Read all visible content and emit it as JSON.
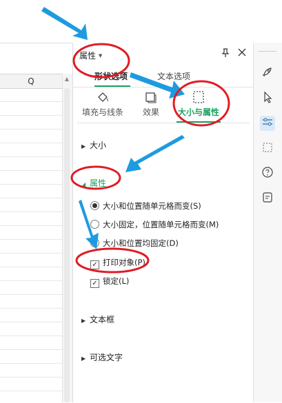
{
  "sheet": {
    "column_label": "Q"
  },
  "panel": {
    "title": "属性",
    "title_dropdown_icon": "chevron-down-icon",
    "tabs": [
      {
        "label": "形状选项",
        "active": true
      },
      {
        "label": "文本选项",
        "active": false
      }
    ],
    "subtabs": [
      {
        "label": "填充与线条",
        "icon": "fill-bucket-icon",
        "active": false
      },
      {
        "label": "效果",
        "icon": "effects-icon",
        "active": false
      },
      {
        "label": "大小与属性",
        "icon": "size-properties-icon",
        "active": true
      }
    ],
    "sections": {
      "size": "大小",
      "properties": "属性",
      "textbox": "文本框",
      "alt_text": "可选文字"
    },
    "radio_options": [
      {
        "label": "大小和位置随单元格而变(S)",
        "checked": true
      },
      {
        "label": "大小固定，位置随单元格而变(M)",
        "checked": false
      },
      {
        "label": "大小和位置均固定(D)",
        "checked": false
      }
    ],
    "checkbox_options": [
      {
        "label": "打印对象(P)",
        "checked": true,
        "mark": "✓"
      },
      {
        "label": "锁定(L)",
        "checked": true,
        "mark": "✓"
      }
    ]
  },
  "toolbar_icons": [
    "rocket-icon",
    "cursor-icon",
    "sliders-icon",
    "select-region-icon",
    "help-icon",
    "clipboard-icon"
  ],
  "colors": {
    "accent": "#1aa15f",
    "annotation_arrow": "#1e9be0",
    "annotation_circle": "#e01b24"
  }
}
